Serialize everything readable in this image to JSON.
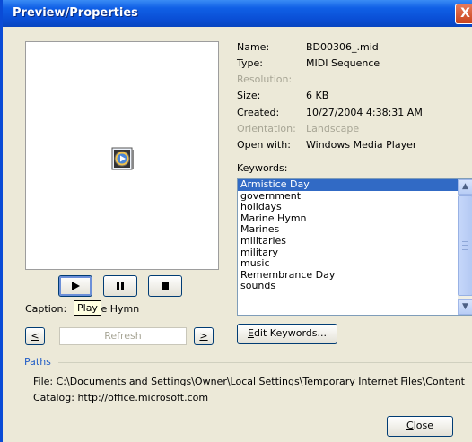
{
  "window": {
    "title": "Preview/Properties",
    "close_glyph": "X"
  },
  "preview": {
    "icon": "midi-media-file-icon"
  },
  "controls": {
    "play_tooltip": "Play"
  },
  "caption": {
    "label": "Caption:",
    "value": "Marine Hymn"
  },
  "nav": {
    "prev_label": "<",
    "next_label": ">",
    "refresh_label": "Refresh"
  },
  "properties": {
    "name_label": "Name:",
    "name_value": "BD00306_.mid",
    "type_label": "Type:",
    "type_value": "MIDI Sequence",
    "resolution_label": "Resolution:",
    "size_label": "Size:",
    "size_value": "6 KB",
    "created_label": "Created:",
    "created_value": "10/27/2004 4:38:31 AM",
    "orientation_label": "Orientation:",
    "orientation_value": "Landscape",
    "openwith_label": "Open with:",
    "openwith_value": "Windows Media Player"
  },
  "keywords": {
    "label": "Keywords:",
    "items": [
      "Armistice Day",
      "government",
      "holidays",
      "Marine Hymn",
      "Marines",
      "militaries",
      "military",
      "music",
      "Remembrance Day",
      "sounds"
    ],
    "selected_index": 0
  },
  "edit_keywords": {
    "mnemonic": "E",
    "rest": "dit Keywords..."
  },
  "paths": {
    "label": "Paths",
    "file": "File: C:\\Documents and Settings\\Owner\\Local Settings\\Temporary Internet Files\\Content",
    "catalog": "Catalog: http://office.microsoft.com"
  },
  "close_button": {
    "mnemonic": "C",
    "rest": "lose"
  },
  "colors": {
    "title_blue": "#0a4fd6",
    "selection": "#316ac5",
    "paths_label": "#215dc6"
  }
}
